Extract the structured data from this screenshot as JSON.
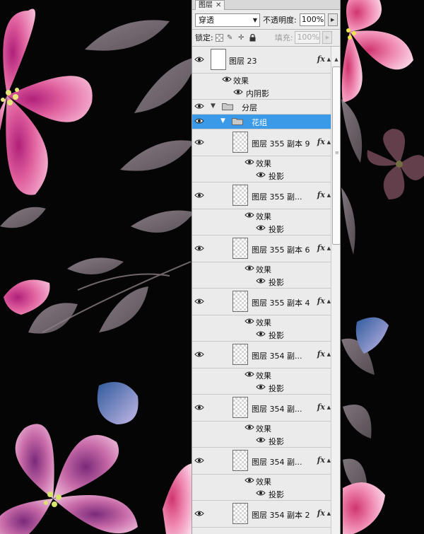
{
  "panel": {
    "tab_label": "图层",
    "tab_close": "✕",
    "blend_mode": "穿透",
    "opacity_label": "不透明度:",
    "opacity_value": "100%",
    "lock_label": "锁定:",
    "fill_label": "填充:",
    "fill_value": "100%"
  },
  "layers": [
    {
      "type": "layer",
      "name": "图层 23",
      "fx": "fx",
      "thumb": "white"
    },
    {
      "type": "effect-header",
      "label": "效果"
    },
    {
      "type": "effect",
      "label": "内阴影"
    },
    {
      "type": "group",
      "name": "分层",
      "expanded": true
    },
    {
      "type": "group",
      "name": "花组",
      "expanded": true,
      "selected": true
    },
    {
      "type": "layer",
      "name": "图层 355 副本 9",
      "fx": "fx"
    },
    {
      "type": "effect-header",
      "label": "效果"
    },
    {
      "type": "effect",
      "label": "投影"
    },
    {
      "type": "layer",
      "name": "图层 355 副...",
      "fx": "fx"
    },
    {
      "type": "effect-header",
      "label": "效果"
    },
    {
      "type": "effect",
      "label": "投影"
    },
    {
      "type": "layer",
      "name": "图层 355 副本 6",
      "fx": "fx"
    },
    {
      "type": "effect-header",
      "label": "效果"
    },
    {
      "type": "effect",
      "label": "投影"
    },
    {
      "type": "layer",
      "name": "图层 355 副本 4",
      "fx": "fx"
    },
    {
      "type": "effect-header",
      "label": "效果"
    },
    {
      "type": "effect",
      "label": "投影"
    },
    {
      "type": "layer",
      "name": "图层 354 副...",
      "fx": "fx"
    },
    {
      "type": "effect-header",
      "label": "效果"
    },
    {
      "type": "effect",
      "label": "投影"
    },
    {
      "type": "layer",
      "name": "图层 354 副...",
      "fx": "fx"
    },
    {
      "type": "effect-header",
      "label": "效果"
    },
    {
      "type": "effect",
      "label": "投影"
    },
    {
      "type": "layer",
      "name": "图层 354 副...",
      "fx": "fx"
    },
    {
      "type": "effect-header",
      "label": "效果"
    },
    {
      "type": "effect",
      "label": "投影"
    },
    {
      "type": "layer",
      "name": "图层 354 副本 2",
      "fx": "fx"
    }
  ],
  "colors": {
    "selection": "#3b9ae8",
    "panel_bg": "#ebebeb",
    "canvas_bg": "#050505"
  },
  "icons": {
    "eye": "eye-icon",
    "folder": "folder-icon",
    "lock_transparent": "lock-transparent-pixels-icon",
    "lock_image": "lock-image-pixels-icon",
    "lock_position": "lock-position-icon",
    "lock_all": "lock-all-icon",
    "fx": "fx-icon"
  }
}
